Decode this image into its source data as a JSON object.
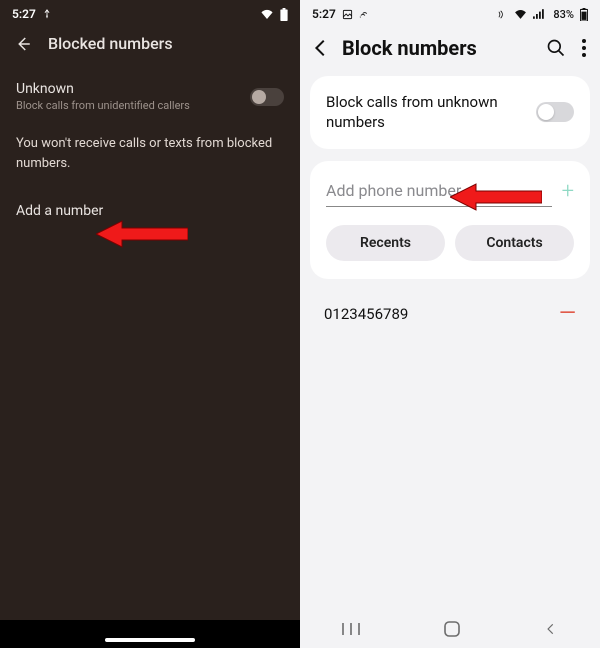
{
  "left": {
    "status_time": "5:27",
    "title": "Blocked numbers",
    "unknown_label": "Unknown",
    "unknown_sub": "Block calls from unidentified callers",
    "info": "You won't receive calls or texts from blocked numbers.",
    "add_label": "Add a number"
  },
  "right": {
    "status_time": "5:27",
    "battery_pct": "83%",
    "title": "Block numbers",
    "unknown_label": "Block calls from unknown numbers",
    "input_placeholder": "Add phone number",
    "recents_label": "Recents",
    "contacts_label": "Contacts",
    "blocked_numbers": [
      "0123456789"
    ]
  }
}
